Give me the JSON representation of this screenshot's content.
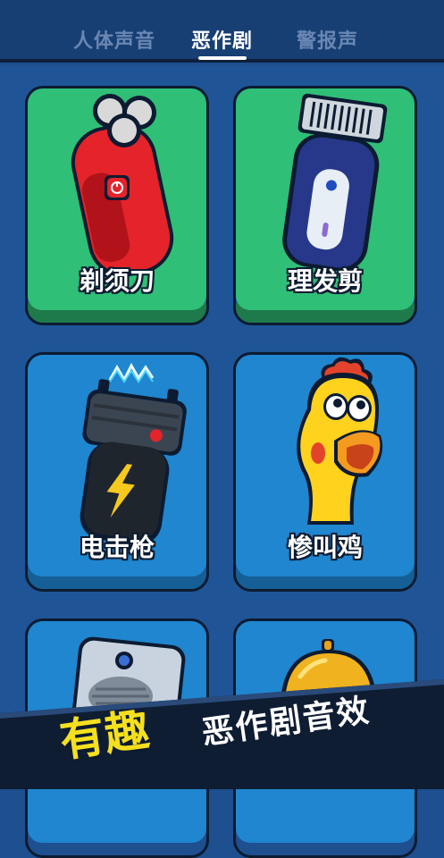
{
  "tabs": [
    {
      "label": "人体声音",
      "active": false
    },
    {
      "label": "恶作剧",
      "active": true
    },
    {
      "label": "警报声",
      "active": false
    }
  ],
  "cards": [
    {
      "label": "剃须刀",
      "icon": "shaver-icon",
      "color": "green"
    },
    {
      "label": "理发剪",
      "icon": "hair-clipper-icon",
      "color": "green"
    },
    {
      "label": "电击枪",
      "icon": "stun-gun-icon",
      "color": "blue"
    },
    {
      "label": "惨叫鸡",
      "icon": "screaming-chicken-icon",
      "color": "blue"
    },
    {
      "label": "",
      "icon": "speaker-device-icon",
      "color": "blue"
    },
    {
      "label": "",
      "icon": "service-bell-icon",
      "color": "blue"
    }
  ],
  "banner": {
    "fun": "有趣",
    "text": "恶作剧音效"
  },
  "colors": {
    "accent_yellow": "#f5e01e",
    "card_green": "#2fbf77",
    "card_blue": "#1f86cf",
    "background": "#1e4f8f"
  }
}
